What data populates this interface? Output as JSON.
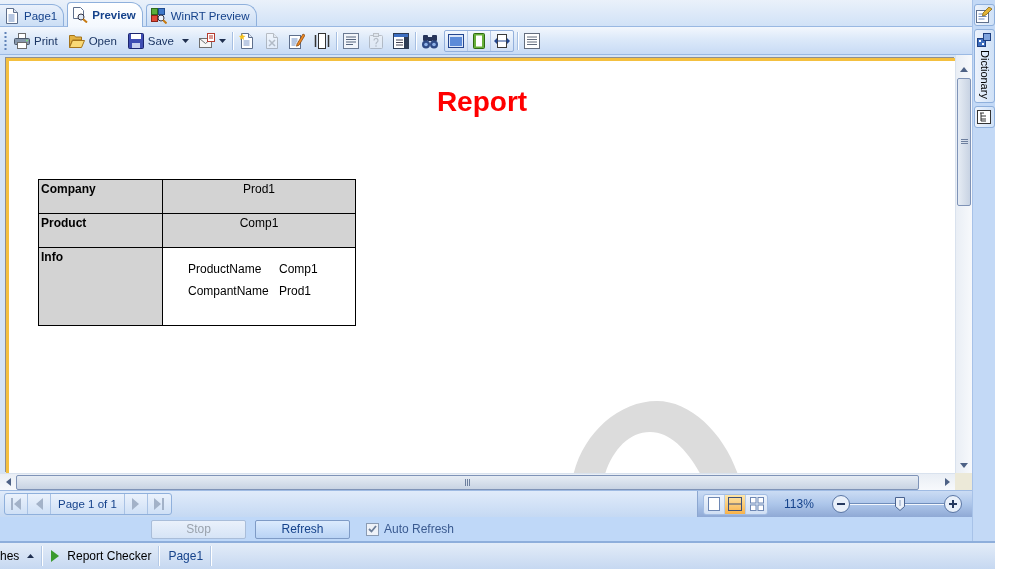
{
  "tabs": [
    {
      "label": "Page1",
      "selected": false
    },
    {
      "label": "Preview",
      "selected": true
    },
    {
      "label": "WinRT Preview",
      "selected": false
    }
  ],
  "toolbar": [
    {
      "kind": "button",
      "label": "Print",
      "disabled": false
    },
    {
      "kind": "button",
      "label": "Open",
      "disabled": false
    },
    {
      "kind": "split",
      "label": "Save",
      "disabled": false
    },
    {
      "kind": "split",
      "disabled": false
    },
    {
      "kind": "separator"
    },
    {
      "kind": "icon",
      "disabled": false
    },
    {
      "kind": "icon",
      "disabled": true
    },
    {
      "kind": "icon",
      "disabled": false
    },
    {
      "kind": "icon",
      "disabled": false
    },
    {
      "kind": "separator"
    },
    {
      "kind": "icon",
      "disabled": false
    },
    {
      "kind": "icon",
      "disabled": true
    },
    {
      "kind": "icon",
      "disabled": false
    },
    {
      "kind": "separator"
    },
    {
      "kind": "icon",
      "disabled": false
    },
    {
      "kind": "toggle",
      "disabled": false
    },
    {
      "kind": "toggle",
      "disabled": false
    },
    {
      "kind": "toggle",
      "disabled": false
    },
    {
      "kind": "separator"
    },
    {
      "kind": "icon",
      "disabled": false
    }
  ],
  "side_panel": {
    "tabs": [
      {
        "label": "Dictionary"
      }
    ]
  },
  "report": {
    "title": "Report",
    "rows": [
      {
        "kind": "text",
        "label": "Company",
        "value": "Prod1"
      },
      {
        "kind": "text",
        "label": "Product",
        "value": "Comp1"
      },
      {
        "kind": "fields",
        "label": "Info",
        "fields": [
          {
            "name": "ProductName",
            "value": "Comp1"
          },
          {
            "name": "CompantName",
            "value": "Prod1"
          }
        ]
      }
    ]
  },
  "pager": {
    "label": "Page 1 of 1",
    "buttons": [
      {
        "kind": "first",
        "disabled": true
      },
      {
        "kind": "prev",
        "disabled": true
      },
      {
        "kind": "next",
        "disabled": true
      },
      {
        "kind": "last",
        "disabled": true
      }
    ]
  },
  "view_modes": [
    {
      "selected": false
    },
    {
      "selected": true
    },
    {
      "selected": false
    }
  ],
  "zoom": {
    "reading": "113%",
    "level": 0.53
  },
  "actions": {
    "buttons": [
      {
        "label": "Stop",
        "disabled": true
      },
      {
        "label": "Refresh",
        "disabled": false
      }
    ],
    "auto_refresh": {
      "label": "Auto Refresh",
      "checked": true
    }
  },
  "status_bar": [
    {
      "kind": "dropdown",
      "label": "hes"
    },
    {
      "kind": "run",
      "label": "Report Checker"
    },
    {
      "kind": "link",
      "label": "Page1"
    }
  ]
}
